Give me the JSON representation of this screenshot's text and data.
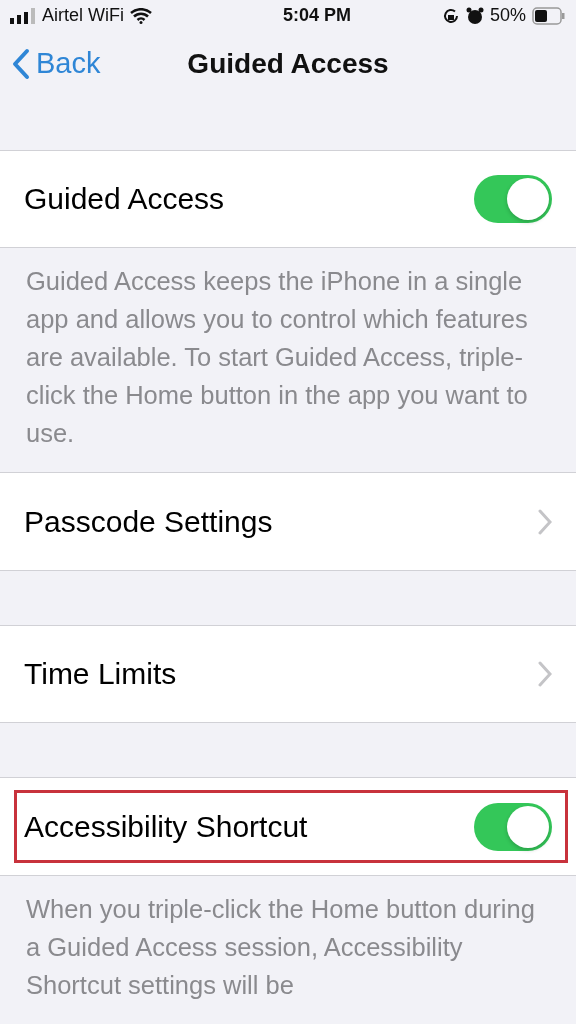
{
  "status_bar": {
    "carrier": "Airtel WiFi",
    "time": "5:04 PM",
    "battery": "50%"
  },
  "nav": {
    "back": "Back",
    "title": "Guided Access"
  },
  "sections": [
    {
      "kind": "toggle",
      "label": "Guided Access",
      "on": true,
      "highlighted": false,
      "footer": "Guided Access keeps the iPhone in a single app and allows you to control which features are available. To start Guided Access, triple-click the Home button in the app you want to use."
    },
    {
      "kind": "link",
      "label": "Passcode Settings",
      "highlighted": false
    },
    {
      "kind": "link",
      "label": "Time Limits",
      "highlighted": false
    },
    {
      "kind": "toggle",
      "label": "Accessibility Shortcut",
      "on": true,
      "highlighted": true,
      "footer": "When you triple-click the Home button during a Guided Access session, Accessibility Shortcut settings will be"
    }
  ]
}
